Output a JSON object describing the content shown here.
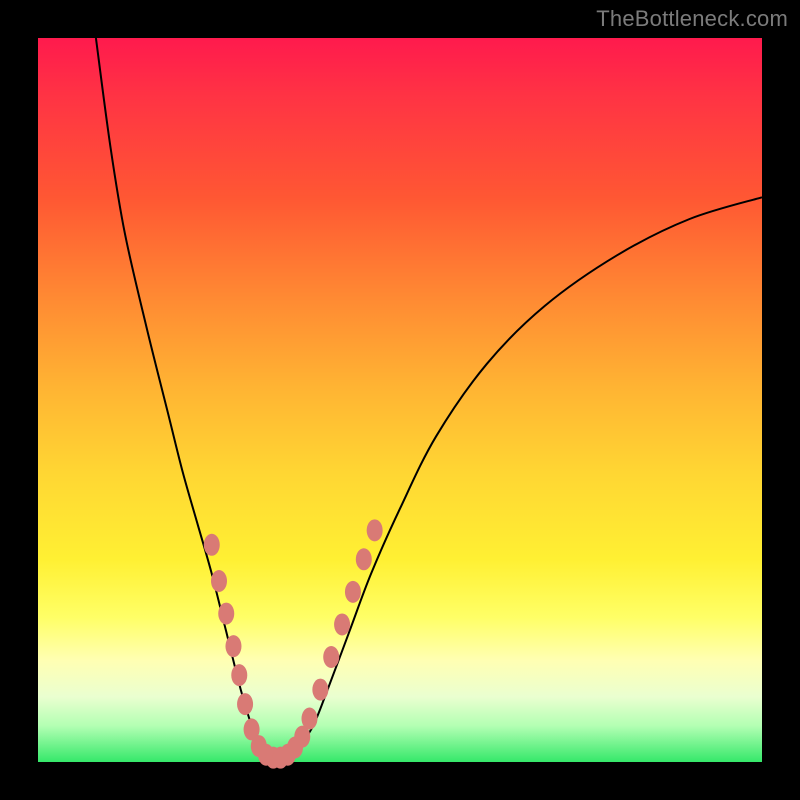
{
  "watermark": "TheBottleneck.com",
  "colors": {
    "frame": "#000000",
    "gradient_top": "#ff1a4d",
    "gradient_bottom": "#35e86a",
    "curve": "#000000",
    "marker": "#d97a75"
  },
  "chart_data": {
    "type": "line",
    "title": "",
    "xlabel": "",
    "ylabel": "",
    "xlim": [
      0,
      100
    ],
    "ylim": [
      0,
      100
    ],
    "note": "V-shaped bottleneck curve. x is relative component score (0–100 across plot width); y is bottleneck severity (0 = no bottleneck / green bottom, 100 = severe / red top). Values estimated from pixel positions; no axis ticks are shown.",
    "series": [
      {
        "name": "left-branch",
        "x": [
          8,
          10,
          12,
          15,
          18,
          20,
          22,
          24,
          26,
          28,
          29.5,
          30.5,
          31.5,
          32
        ],
        "y": [
          100,
          85,
          73,
          60,
          48,
          40,
          33,
          26,
          18,
          10,
          5,
          2.5,
          1,
          0.5
        ]
      },
      {
        "name": "right-branch",
        "x": [
          34,
          35,
          36,
          38,
          40,
          43,
          46,
          50,
          55,
          62,
          70,
          80,
          90,
          100
        ],
        "y": [
          0.5,
          1,
          2,
          5,
          10,
          18,
          26,
          35,
          45,
          55,
          63,
          70,
          75,
          78
        ]
      }
    ],
    "markers": {
      "name": "highlighted-points",
      "note": "Salmon dot clusters near the minimum on both branches, approximated as midpoints in plot-percent coordinates.",
      "points": [
        {
          "x": 24.0,
          "y": 30.0
        },
        {
          "x": 25.0,
          "y": 25.0
        },
        {
          "x": 26.0,
          "y": 20.5
        },
        {
          "x": 27.0,
          "y": 16.0
        },
        {
          "x": 27.8,
          "y": 12.0
        },
        {
          "x": 28.6,
          "y": 8.0
        },
        {
          "x": 29.5,
          "y": 4.5
        },
        {
          "x": 30.5,
          "y": 2.2
        },
        {
          "x": 31.5,
          "y": 1.0
        },
        {
          "x": 32.5,
          "y": 0.6
        },
        {
          "x": 33.5,
          "y": 0.6
        },
        {
          "x": 34.5,
          "y": 1.0
        },
        {
          "x": 35.5,
          "y": 2.0
        },
        {
          "x": 36.5,
          "y": 3.5
        },
        {
          "x": 37.5,
          "y": 6.0
        },
        {
          "x": 39.0,
          "y": 10.0
        },
        {
          "x": 40.5,
          "y": 14.5
        },
        {
          "x": 42.0,
          "y": 19.0
        },
        {
          "x": 43.5,
          "y": 23.5
        },
        {
          "x": 45.0,
          "y": 28.0
        },
        {
          "x": 46.5,
          "y": 32.0
        }
      ]
    }
  }
}
